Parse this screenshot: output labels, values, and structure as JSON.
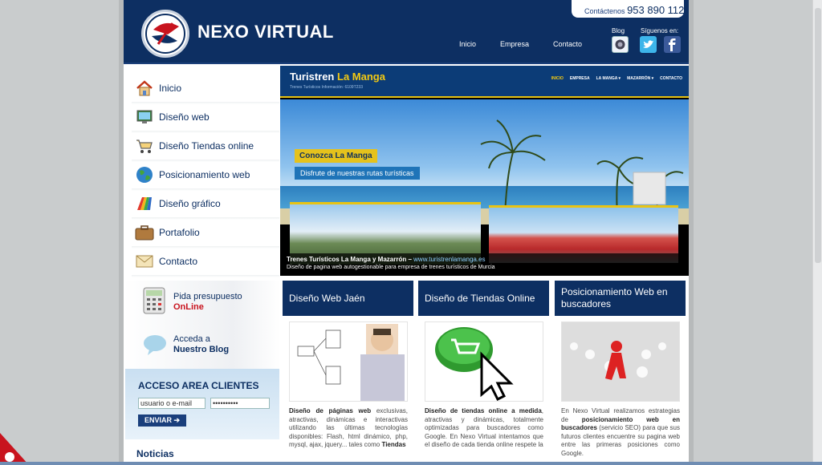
{
  "header": {
    "logo_text": "NEXO VIRTUAL",
    "contact_label": "Contáctenos",
    "contact_phone": "953 890 112",
    "nav": [
      "Inicio",
      "Empresa",
      "Contacto"
    ],
    "blog_label": "Blog",
    "social_label": "Síguenos en:"
  },
  "sidebar": {
    "menu": [
      {
        "label": "Inicio",
        "icon": "home-icon"
      },
      {
        "label": "Diseño web",
        "icon": "monitor-icon"
      },
      {
        "label": "Diseño Tiendas online",
        "icon": "cart-icon"
      },
      {
        "label": "Posicionamiento web",
        "icon": "globe-icon"
      },
      {
        "label": "Diseño gráfico",
        "icon": "palette-icon"
      },
      {
        "label": "Portafolio",
        "icon": "briefcase-icon"
      },
      {
        "label": "Contacto",
        "icon": "envelope-icon"
      }
    ],
    "presupuesto_line1": "Pida presupuesto",
    "presupuesto_line2": "OnLine",
    "blog_line1": "Acceda a",
    "blog_line2": "Nuestro Blog",
    "login_title": "ACCESO AREA CLIENTES",
    "user_value": "usuario o e-mail",
    "password_value": "••••••••••",
    "enviar": "ENVIAR",
    "noticias": "Noticias"
  },
  "slider": {
    "site_title_a": "Turistren",
    "site_title_b": "La Manga",
    "site_sub": "Trenes Turísticos  Información: 6109T233",
    "mini_nav": [
      "INICIO",
      "EMPRESA",
      "LA MANGA ▾",
      "MAZARRÓN ▾",
      "CONTACTO"
    ],
    "tag1": "Conozca La Manga",
    "tag2": "Disfrute de nuestras rutas turísticas",
    "caption_title": "Trenes Turísticos La Manga y Mazarrón –",
    "caption_url": "www.turistrenlamanga.es",
    "caption_desc": "Diseño de pagina web autogestionable para empresa de trenes turísticos de Murcia"
  },
  "boxes": [
    {
      "title": "Diseño Web Jaén",
      "text_html": "<b>Diseño de páginas web</b> exclusivas, atractivas, dinámicas e interactivas utilizando las últimas tecnologías disponibles: Flash, html dinámico, php, mysql, ajax, jquery... tales como <b>Tiendas</b>"
    },
    {
      "title": "Diseño de Tiendas Online",
      "text_html": "<b>Diseño de tiendas online a medida</b>, atractivas y dinámicas, totalmente optimizadas para buscadores como Google. En Nexo Virtual intentamos que el diseño de cada tienda online respete la"
    },
    {
      "title": "Posicionamiento Web en buscadores",
      "text_html": "En Nexo Virtual realizamos estrategias de <b>posicionamiento web en buscadores</b> (servicio SEO) para que sus futuros clientes encuentre su pagina web entre las primeras posiciones como Google."
    }
  ]
}
